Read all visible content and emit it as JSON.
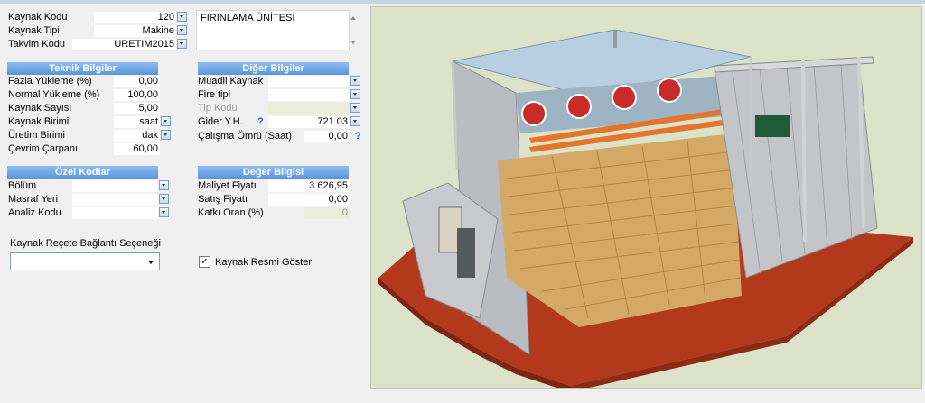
{
  "general": {
    "kaynak_kodu_label": "Kaynak Kodu",
    "kaynak_kodu_value": "120",
    "kaynak_tipi_label": "Kaynak Tipi",
    "kaynak_tipi_value": "Makine",
    "takvim_kodu_label": "Takvim Kodu",
    "takvim_kodu_value": "URETIM2015",
    "description": "FIRINLAMA ÜNİTESİ"
  },
  "teknik": {
    "header": "Teknik Bilgiler",
    "rows": [
      {
        "label": "Fazla Yükleme (%)",
        "value": "0,00"
      },
      {
        "label": "Normal Yükleme (%)",
        "value": "100,00"
      },
      {
        "label": "Kaynak Sayısı",
        "value": "5,00"
      },
      {
        "label": "Kaynak Birimi",
        "value": "saat"
      },
      {
        "label": "Üretim Birimi",
        "value": "dak"
      },
      {
        "label": "Çevrim Çarpanı",
        "value": "60,00"
      }
    ]
  },
  "diger": {
    "header": "Diğer Bilgiler",
    "muadil_label": "Muadil Kaynak",
    "fire_label": "Fire tipi",
    "tip_label": "Tip Kodu",
    "gider_label": "Gider Y.H.",
    "gider_value": "721 03",
    "calisma_label": "Çalışma Ömrü (Saat)",
    "calisma_value": "0,00",
    "help": "?"
  },
  "ozel": {
    "header": "Özel Kodlar",
    "bolum_label": "Bölüm",
    "masraf_label": "Masraf Yeri",
    "analiz_label": "Analiz Kodu"
  },
  "deger": {
    "header": "Değer Bilgisi",
    "maliyet_label": "Maliyet Fiyatı",
    "maliyet_value": "3.626,95",
    "satis_label": "Satış Fiyatı",
    "satis_value": "0,00",
    "katki_label": "Katkı Oran (%)",
    "katki_value": "0"
  },
  "recete": {
    "label": "Kaynak Reçete Bağlantı Seçeneği",
    "value": ""
  },
  "resim": {
    "label": "Kaynak Resmi Göster",
    "checked": true,
    "check_glyph": "✓"
  }
}
